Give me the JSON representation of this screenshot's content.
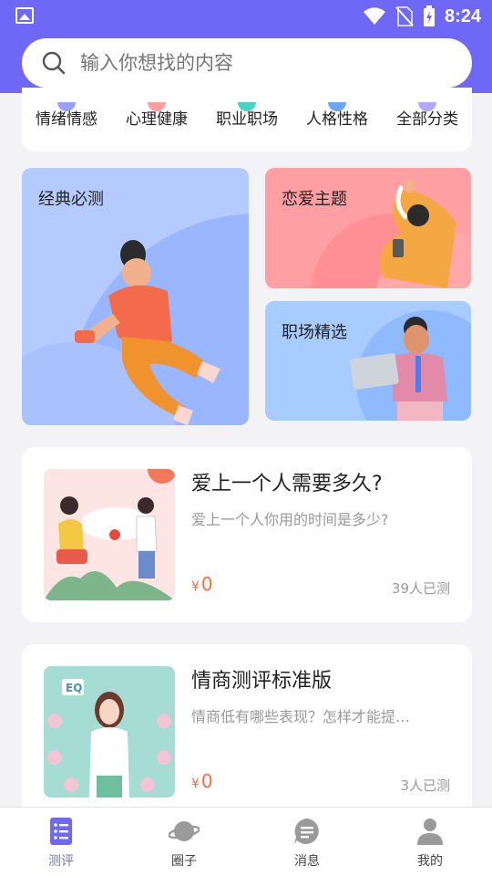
{
  "status_bar": {
    "time": "8:24"
  },
  "search": {
    "placeholder": "输入你想找的内容"
  },
  "categories": [
    {
      "label": "情绪情感",
      "color": "#9aa0ff"
    },
    {
      "label": "心理健康",
      "color": "#ff9ea3"
    },
    {
      "label": "职业职场",
      "color": "#48d3c3"
    },
    {
      "label": "人格性格",
      "color": "#6aa6ff"
    },
    {
      "label": "全部分类",
      "color": "#b0a8ff"
    }
  ],
  "features": {
    "classic": "经典必测",
    "love": "恋爱主题",
    "work": "职场精选"
  },
  "tests": [
    {
      "title": "爱上一个人需要多久?",
      "desc": "爱上一个人你用的时间是多少?",
      "currency": "¥",
      "price": "0",
      "count": "39人已测"
    },
    {
      "title": "情商测评标准版",
      "desc": "情商低有哪些表现？怎样才能提…",
      "currency": "¥",
      "price": "0",
      "count": "3人已测",
      "badge": "EQ"
    }
  ],
  "nav": [
    {
      "label": "测评"
    },
    {
      "label": "圈子"
    },
    {
      "label": "消息"
    },
    {
      "label": "我的"
    }
  ],
  "colors": {
    "primary": "#6f68f6",
    "price": "#ff6a3d"
  }
}
